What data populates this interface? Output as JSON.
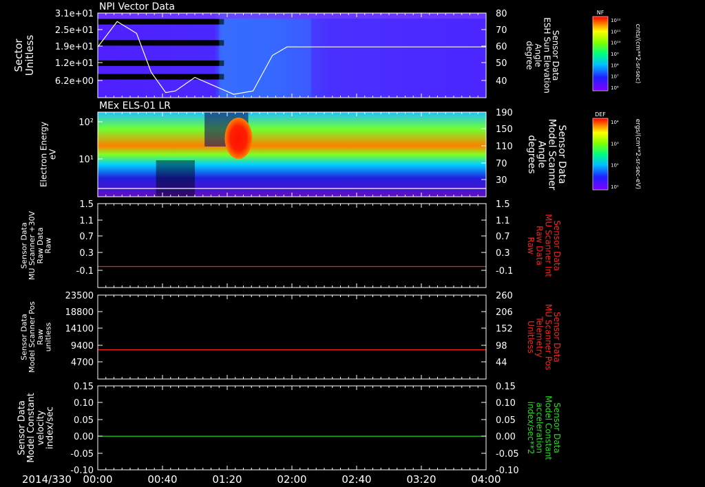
{
  "date_label": "2014/330",
  "time_ticks": [
    "00:00",
    "00:40",
    "01:20",
    "02:00",
    "02:40",
    "03:20",
    "04:00"
  ],
  "chart_data": [
    {
      "type": "heatmap",
      "title": "NPI Vector Data",
      "ylabel_left": [
        "Sector",
        "Unitless"
      ],
      "yticks_left": [
        "3.1e+01",
        "2.5e+01",
        "1.9e+01",
        "1.2e+01",
        "6.2e+00"
      ],
      "ylabel_right": [
        "Sensor Data",
        "ESH Sun Elevation",
        "Angle",
        "degree"
      ],
      "yticks_right": [
        "80",
        "70",
        "60",
        "50",
        "40"
      ],
      "overlay_line": {
        "color": "#ffffff",
        "x_hours": [
          0,
          0.2,
          0.4,
          0.55,
          0.7,
          0.8,
          1.0,
          1.2,
          1.4,
          1.6,
          1.8,
          1.95,
          4.0
        ],
        "y_deg": [
          60,
          75,
          68,
          45,
          33,
          34,
          42,
          37,
          32,
          34,
          55,
          60,
          60
        ]
      },
      "colorbar": {
        "label": "NF",
        "ticks": [
          "10¹²",
          "10¹¹",
          "10¹⁰",
          "10⁹",
          "10⁸",
          "10⁷",
          "10⁶"
        ],
        "units": "cnts/(cm**2-sr-sec)"
      }
    },
    {
      "type": "heatmap",
      "title": "MEx ELS-01 LR",
      "ylabel_left": [
        "Electron Energy",
        "eV"
      ],
      "yticks_left": [
        "10²",
        "10¹"
      ],
      "ylabel_right": [
        "Sensor Data",
        "Model Scanner",
        "Angle",
        "degrees"
      ],
      "yticks_right": [
        "190",
        "150",
        "110",
        "70",
        "30"
      ],
      "overlay_line": {
        "color": "#ffffff",
        "y_deg": 10
      },
      "colorbar": {
        "label": "DEF",
        "ticks": [
          "10⁴",
          "10³",
          "10²",
          "10¹"
        ],
        "units": "ergs/(cm**2-sr-sec-eV)"
      }
    },
    {
      "type": "line",
      "ylabel_left": [
        "Sensor Data",
        "MU Scanner +30V",
        "Raw Data",
        "Raw"
      ],
      "yticks_left": [
        "1.5",
        "1.1",
        "0.7",
        "0.3",
        "-0.1"
      ],
      "ylabel_right": [
        "Sensor Data",
        "MU Scanner Int",
        "Raw Data",
        "Raw"
      ],
      "ylabel_right_color": "#ff2020",
      "yticks_right": [
        "1.5",
        "1.1",
        "0.7",
        "0.3",
        "-0.1"
      ],
      "ylim": [
        -0.5,
        1.5
      ],
      "series": [
        {
          "color": "#ff2020",
          "y": 0.0
        }
      ]
    },
    {
      "type": "line",
      "ylabel_left": [
        "Sensor Data",
        "Model Scanner Pos",
        "Raw",
        "unitless"
      ],
      "yticks_left": [
        "23500",
        "18800",
        "14100",
        "9400",
        "4700"
      ],
      "ylabel_right": [
        "Sensor Data",
        "MU Scanner Pos",
        "Telemetry",
        "Unitless"
      ],
      "ylabel_right_color": "#ff2020",
      "yticks_right": [
        "260",
        "206",
        "152",
        "98",
        "44"
      ],
      "ylim": [
        0,
        23500
      ],
      "series": [
        {
          "color": "#ff2020",
          "y": 8200
        }
      ]
    },
    {
      "type": "line",
      "ylabel_left": [
        "Sensor Data",
        "Model Constant",
        "velocity",
        "index/sec"
      ],
      "yticks_left": [
        "0.15",
        "0.10",
        "0.05",
        "0.00",
        "-0.05",
        "-0.10"
      ],
      "ylabel_right": [
        "Sensor Data",
        "Model Constant",
        "acceleration",
        "index/sec**2"
      ],
      "ylabel_right_color": "#20e020",
      "yticks_right": [
        "0.15",
        "0.10",
        "0.05",
        "0.00",
        "-0.05",
        "-0.10"
      ],
      "ylim": [
        -0.1,
        0.15
      ],
      "series": [
        {
          "color": "#20e020",
          "y": 0.0
        }
      ]
    }
  ]
}
